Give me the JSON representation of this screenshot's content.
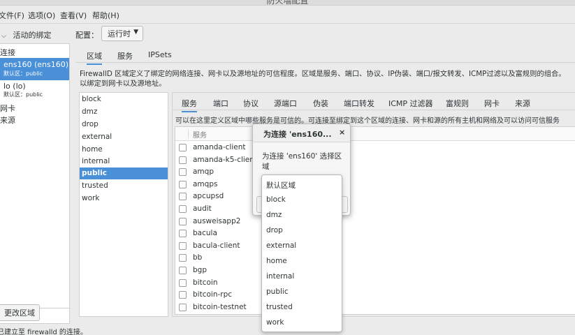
{
  "window": {
    "title": "防火墙配置"
  },
  "menubar": [
    "文件(F)",
    "选项(O)",
    "查看(V)",
    "帮助(H)"
  ],
  "left": {
    "header": "活动的绑定",
    "section_connections": "连接",
    "connections": [
      {
        "name": "ens160 (ens160)",
        "zone": "默认区：public"
      },
      {
        "name": "lo (lo)",
        "zone": "默认区：public"
      }
    ],
    "section_interfaces": "网卡",
    "section_sources": "来源",
    "change_zone_button": "更改区域"
  },
  "config": {
    "label": "配置：",
    "value": "运行时"
  },
  "top_tabs": [
    "区域",
    "服务",
    "IPSets"
  ],
  "zone_description": {
    "line1": "FirewallD 区域定义了绑定的网络连接、网卡以及源地址的可信程度。区域是服务、端口、协议、IP伪装、端口/报文转发、ICMP过滤以及富规则的组合。",
    "line2": "以绑定到网卡以及源地址。"
  },
  "zones": [
    "block",
    "dmz",
    "drop",
    "external",
    "home",
    "internal",
    "public",
    "trusted",
    "work"
  ],
  "selected_zone": "public",
  "inner_tabs": [
    "服务",
    "端口",
    "协议",
    "源端口",
    "伪装",
    "端口转发",
    "ICMP 过滤器",
    "富规则",
    "网卡",
    "来源"
  ],
  "services_description": "可以在这里定义区域中哪些服务是可信的。可连接至绑定到这个区域的连接、网卡和源的所有主机和网络及可以访问可信服务",
  "services_header": "服务",
  "services": [
    "amanda-client",
    "amanda-k5-client",
    "amqp",
    "amqps",
    "apcupsd",
    "audit",
    "ausweisapp2",
    "bacula",
    "bacula-client",
    "bb",
    "bgp",
    "bitcoin",
    "bitcoin-rpc",
    "bitcoin-testnet"
  ],
  "status": "已建立至 firewalld 的连接。",
  "dialog": {
    "title": "为连接 'ens160...",
    "close": "×",
    "text": "为连接 'ens160' 选择区域"
  },
  "zone_dropdown": [
    "默认区域",
    "block",
    "dmz",
    "drop",
    "external",
    "home",
    "internal",
    "public",
    "trusted",
    "work"
  ],
  "colors": {
    "accent": "#4a90d9"
  }
}
